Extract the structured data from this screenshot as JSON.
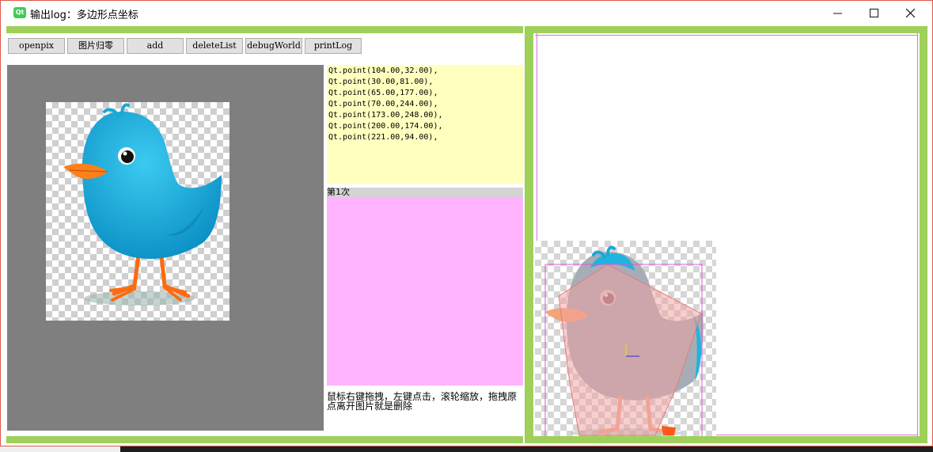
{
  "window": {
    "app_icon_text": "Qt",
    "title": "输出log：多边形点坐标",
    "controls": {
      "minimize_glyph": "—",
      "maximize_glyph": "☐",
      "close_glyph": "✕"
    }
  },
  "toolbar": {
    "buttons": [
      "openpix",
      "图片归零",
      "add",
      "deleteList",
      "debugWorld",
      "printLog"
    ]
  },
  "log": {
    "lines": [
      "Qt.point(104.00,32.00),",
      "Qt.point(30.00,81.00),",
      "Qt.point(65.00,177.00),",
      "Qt.point(70.00,244.00),",
      "Qt.point(173.00,248.00),",
      "Qt.point(200.00,174.00),",
      "Qt.point(221.00,94.00),"
    ]
  },
  "counter_label": "第1次",
  "hint": "鼠标右键拖拽，左键点击，滚轮缩放，拖拽原点离开图片就是删除",
  "colors": {
    "frame_green": "#9ed05a",
    "log_background": "#ffffbf",
    "pink_panel": "#ffb3ff",
    "gray_view": "#7f7f7f",
    "bird_blue": "#1fb3e0",
    "beak_orange": "#ff7f1a",
    "polygon_fill": "#f2a0a0"
  },
  "icons": {
    "image_left": "bird-image",
    "image_right": "bird-image-with-polygon-overlay"
  }
}
